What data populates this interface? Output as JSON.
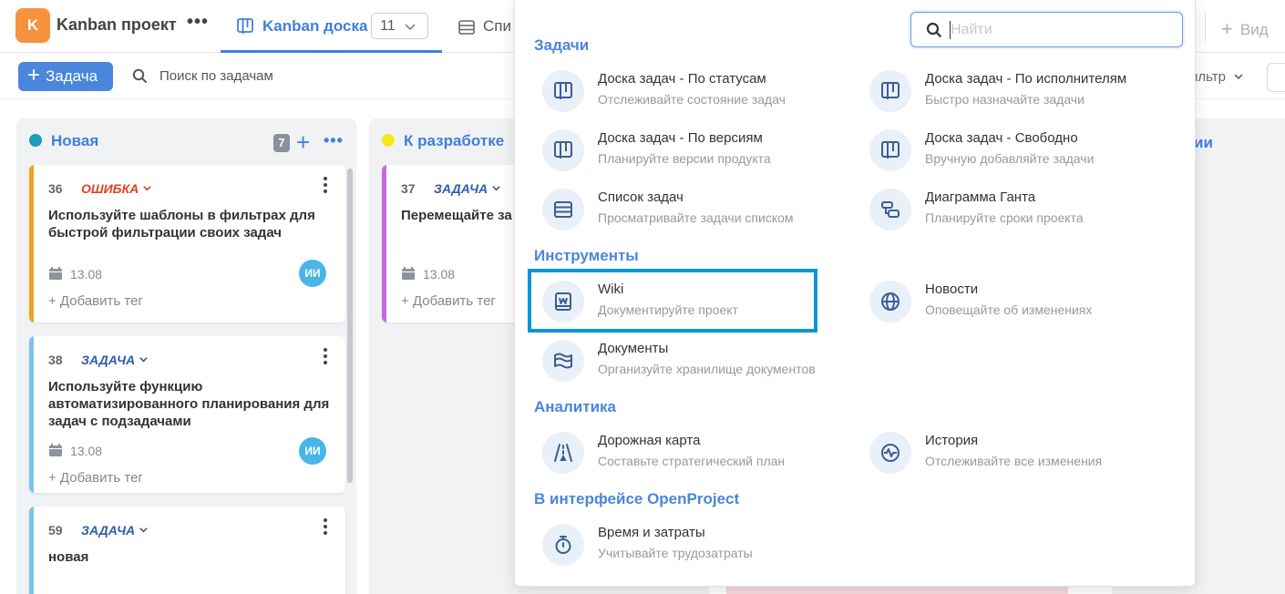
{
  "topbar": {
    "project_initial": "K",
    "project_name": "Kanban проект",
    "more_glyph": "•••",
    "tab_board_label": "Kanban доска",
    "tab_board_count": "11",
    "tab_list_label": "Спи",
    "view_label": "Вид"
  },
  "toolbar": {
    "add_task_label": "Задача",
    "search_label": "Поиск по задачам",
    "filter_label": "ильтр"
  },
  "columns": [
    {
      "title": "Новая",
      "dot_color": "#1e9db5",
      "count": "7",
      "cards": [
        {
          "num": "36",
          "type": "ОШИБКА",
          "type_color": "#e0402a",
          "bar_color": "#f2a21c",
          "title": "Используйте шаблоны в фильтрах для быстрой фильтрации своих задач",
          "date": "13.08",
          "assignee": "ИИ",
          "add_tag": "+ Добавить тег"
        },
        {
          "num": "38",
          "type": "ЗАДАЧА",
          "type_color": "#2d5fae",
          "bar_color": "#7cc3ee",
          "title": "Используйте функцию автоматизированного планирования для задач с подзадачами",
          "date": "13.08",
          "assignee": "ИИ",
          "add_tag": "+ Добавить тег"
        },
        {
          "num": "59",
          "type": "ЗАДАЧА",
          "type_color": "#2d5fae",
          "bar_color": "#7cc3ee",
          "title": "новая"
        }
      ]
    },
    {
      "title": "К разработке",
      "dot_color": "#f4ea1b",
      "cards": [
        {
          "num": "37",
          "type": "ЗАДАЧА",
          "type_color": "#2d5fae",
          "bar_color": "#c56ae0",
          "title": "Перемещайте за",
          "date": "13.08",
          "add_tag": "+ Добавить тег"
        }
      ]
    },
    {
      "title": "ии"
    }
  ],
  "dropdown": {
    "search_placeholder": "Найти",
    "sections": [
      {
        "title": "Задачи",
        "items": [
          {
            "name": "Доска задач - По статусам",
            "desc": "Отслеживайте состояние задач",
            "icon": "board-icon"
          },
          {
            "name": "Доска задач - По исполнителям",
            "desc": "Быстро назначайте задачи",
            "icon": "board-icon"
          },
          {
            "name": "Доска задач - По версиям",
            "desc": "Планируйте версии продукта",
            "icon": "board-icon"
          },
          {
            "name": "Доска задач - Свободно",
            "desc": "Вручную добавляйте задачи",
            "icon": "board-icon"
          },
          {
            "name": "Список задач",
            "desc": "Просматривайте задачи списком",
            "icon": "list-icon"
          },
          {
            "name": "Диаграмма Ганта",
            "desc": "Планируйте сроки проекта",
            "icon": "gantt-icon"
          }
        ]
      },
      {
        "title": "Инструменты",
        "items": [
          {
            "name": "Wiki",
            "desc": "Документируйте проект",
            "icon": "wiki-icon",
            "highlighted": true
          },
          {
            "name": "Новости",
            "desc": "Оповещайте об изменениях",
            "icon": "globe-icon"
          },
          {
            "name": "Документы",
            "desc": "Организуйте хранилище документов",
            "icon": "documents-icon"
          }
        ]
      },
      {
        "title": "Аналитика",
        "items": [
          {
            "name": "Дорожная карта",
            "desc": "Составьте стратегический план",
            "icon": "roadmap-icon"
          },
          {
            "name": "История",
            "desc": "Отслеживайте все изменения",
            "icon": "activity-icon"
          }
        ]
      },
      {
        "title": "В интерфейсе OpenProject",
        "items": [
          {
            "name": "Время и затраты",
            "desc": "Учитывайте трудозатраты",
            "icon": "stopwatch-icon"
          }
        ]
      }
    ]
  }
}
